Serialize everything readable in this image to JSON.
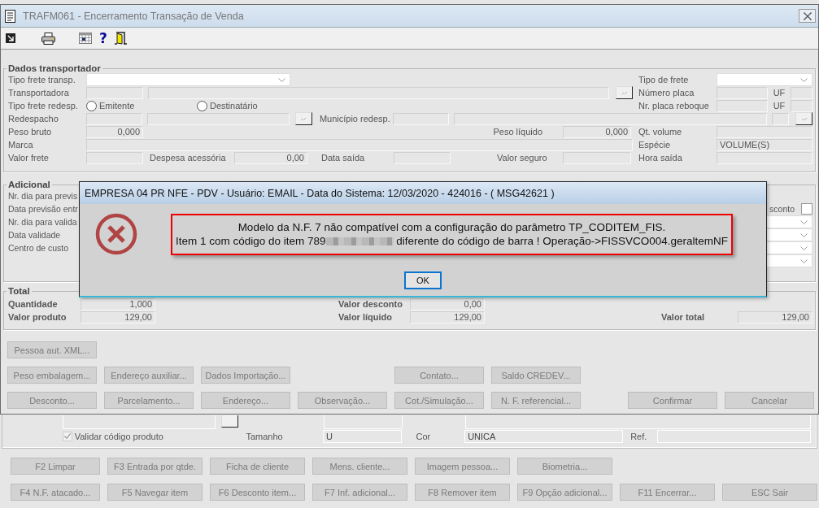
{
  "background_form": {
    "validate": {
      "label": "Validar código produto",
      "checked": true,
      "disabled": true
    },
    "tamanho_label": "Tamanho",
    "tamanho_value": "U",
    "cor_label": "Cor",
    "cor_value": "UNICA",
    "ref_label": "Ref."
  },
  "background_buttons": [
    {
      "buttons": [
        {
          "label": "F2 Limpar",
          "disabled": true
        },
        {
          "label": "F3 Entrada por qtde.",
          "disabled": true
        },
        {
          "label": "Ficha de cliente",
          "disabled": true
        },
        {
          "label": "Mens. cliente...",
          "disabled": true
        },
        {
          "label": "Imagem pessoa...",
          "disabled": true
        },
        {
          "label": "Biometria...",
          "disabled": true
        }
      ]
    },
    {
      "buttons": [
        {
          "label": "F4 N.F. atacado...",
          "disabled": true
        },
        {
          "label": "F5 Navegar item",
          "disabled": true
        },
        {
          "label": "F6 Desconto item...",
          "disabled": true
        },
        {
          "label": "F7 Inf. adicional...",
          "disabled": true
        },
        {
          "label": "F8 Remover item",
          "disabled": true
        },
        {
          "label": "F9 Opção adicional...",
          "disabled": true
        },
        {
          "label": "F11 Encerrar...",
          "disabled": true
        },
        {
          "label": "ESC Sair",
          "disabled": true
        }
      ]
    }
  ],
  "window": {
    "title": "TRAFM061 - Encerramento Transação de Venda",
    "toolbar": [
      {
        "kind": "arrow"
      },
      {
        "kind": "printer"
      },
      {
        "kind": "grid"
      },
      {
        "kind": "help",
        "glyph": "?"
      },
      {
        "kind": "door"
      }
    ]
  },
  "transport": {
    "title": "Dados transportador",
    "tipo_frete_transp": "Tipo frete transp.",
    "tipo_de_frete": "Tipo de frete",
    "transportadora": "Transportadora",
    "numero_placa": "Número placa",
    "uf_1": "UF",
    "tipo_frete_redesp": "Tipo frete redesp.",
    "radios": [
      {
        "label": "Emitente",
        "selected": false
      },
      {
        "label": "Destinatário",
        "selected": false
      }
    ],
    "nr_placa_reboque": "Nr. placa reboque",
    "uf_2": "UF",
    "redespacho": "Redespacho",
    "municipio_redesp": "Município redesp.",
    "peso_bruto": "Peso bruto",
    "peso_bruto_value": "0,000",
    "peso_liquido": "Peso líquido",
    "peso_liquido_value": "0,000",
    "qt_volume": "Qt. volume",
    "marca": "Marca",
    "especie": "Espécie",
    "especie_value": "VOLUME(S)",
    "valor_frete": "Valor frete",
    "despesa_acessoria": "Despesa acessória",
    "despesa_acessoria_value": "0,00",
    "data_saida": "Data saída",
    "valor_seguro": "Valor seguro",
    "hora_saida": "Hora saída"
  },
  "additional": {
    "title": "Adicional",
    "labels": [
      "Nr. dia para previs",
      "Data previsão entr",
      "Nr. dia para valida",
      "Data validade",
      "Centro de custo"
    ],
    "discount_checkbox": {
      "label": "sconto",
      "checked": false
    }
  },
  "totals": {
    "title": "Total",
    "quantidade": "Quantidade",
    "quantidade_value": "1,000",
    "valor_desconto": "Valor desconto",
    "valor_desconto_value": "0,00",
    "valor_produto": "Valor produto",
    "valor_produto_value": "129,00",
    "valor_liquido": "Valor líquido",
    "valor_liquido_value": "129,00",
    "valor_total": "Valor total",
    "valor_total_value": "129,00"
  },
  "window_buttons": [
    {
      "main": [
        {
          "label": "Pessoa aut. XML...",
          "disabled": true
        }
      ]
    },
    {
      "main": [
        {
          "label": "Peso embalagem...",
          "disabled": true
        },
        {
          "label": "Endereço auxiliar...",
          "disabled": true
        },
        {
          "label": "Dados Importação...",
          "disabled": true
        }
      ],
      "secondary": [
        {
          "label": "Contato...",
          "disabled": true
        },
        {
          "label": "Saldo CREDEV...",
          "disabled": true
        }
      ]
    },
    {
      "main": [
        {
          "label": "Desconto...",
          "disabled": true
        },
        {
          "label": "Parcelamento...",
          "disabled": true
        },
        {
          "label": "Endereço...",
          "disabled": true
        },
        {
          "label": "Observação...",
          "disabled": true
        },
        {
          "label": "Cot./Simulação...",
          "disabled": true
        },
        {
          "label": "N. F. referencial...",
          "disabled": true
        }
      ],
      "confirm": [
        {
          "label": "Confirmar",
          "disabled": true
        },
        {
          "label": "Cancelar",
          "disabled": true
        }
      ]
    }
  ],
  "dialog": {
    "title": "EMPRESA 04 PR NFE - PDV - Usuário: EMAIL - Data do Sistema: 12/03/2020 - 424016 - ( MSG42621 )",
    "message_line1": "Modelo da N.F. 7 não compatível com a configuração do parâmetro TP_CODITEM_FIS.",
    "message_line2_before": "Item 1 com código do item 789",
    "message_line2_after": " diferente do código de barra ! Operação->FISSVCO004.geraltemNF",
    "ok_label": "OK"
  }
}
